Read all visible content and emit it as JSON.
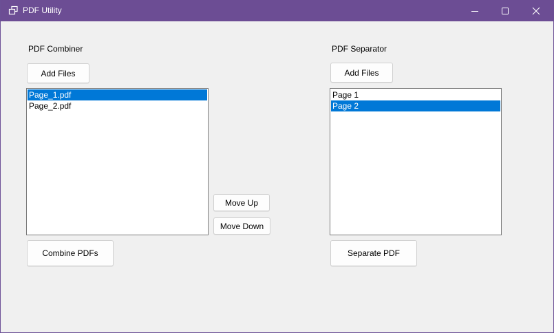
{
  "window": {
    "title": "PDF Utility",
    "titlebar_color": "#6c4d94"
  },
  "combiner": {
    "label": "PDF Combiner",
    "add_files_label": "Add Files",
    "files": [
      {
        "name": "Page_1.pdf",
        "selected": true
      },
      {
        "name": "Page_2.pdf",
        "selected": false
      }
    ],
    "combine_label": "Combine PDFs"
  },
  "reorder": {
    "move_up_label": "Move Up",
    "move_down_label": "Move Down"
  },
  "separator": {
    "label": "PDF Separator",
    "add_files_label": "Add Files",
    "pages": [
      {
        "name": "Page 1",
        "selected": false
      },
      {
        "name": "Page 2",
        "selected": true
      }
    ],
    "separate_label": "Separate PDF"
  },
  "colors": {
    "selection": "#0078d7",
    "window_bg": "#f0f0f0"
  },
  "icons": {
    "app": "restore-windows-icon",
    "minimize": "minimize-icon",
    "maximize": "maximize-icon",
    "close": "close-icon"
  }
}
